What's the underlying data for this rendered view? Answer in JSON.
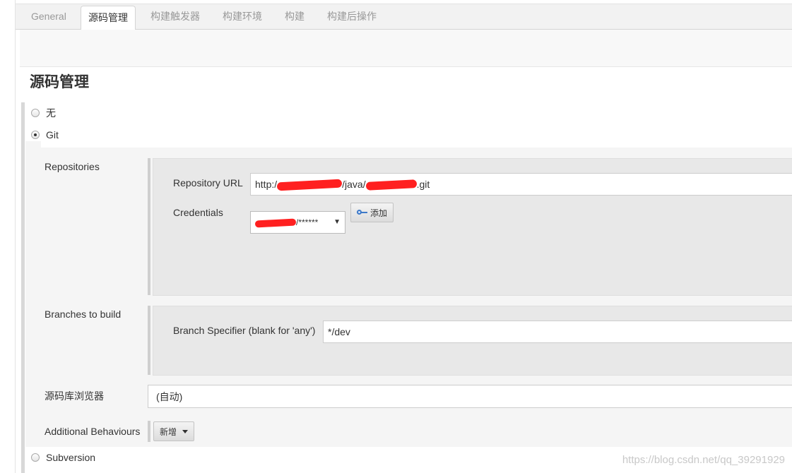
{
  "tabs": [
    {
      "label": "General",
      "active": false
    },
    {
      "label": "源码管理",
      "active": true
    },
    {
      "label": "构建触发器",
      "active": false
    },
    {
      "label": "构建环境",
      "active": false
    },
    {
      "label": "构建",
      "active": false
    },
    {
      "label": "构建后操作",
      "active": false
    }
  ],
  "section_title": "源码管理",
  "scm_options": {
    "none": {
      "label": "无",
      "selected": false
    },
    "git": {
      "label": "Git",
      "selected": true
    },
    "subversion": {
      "label": "Subversion",
      "selected": false
    }
  },
  "repositories": {
    "label": "Repositories",
    "url_label": "Repository URL",
    "url_prefix": "http:/",
    "url_mid": "/java/",
    "url_suffix": ".git",
    "credentials_label": "Credentials",
    "credentials_value": "/******",
    "add_button": "添加",
    "add_icon": "key-icon"
  },
  "branches": {
    "label": "Branches to build",
    "specifier_label": "Branch Specifier (blank for 'any')",
    "specifier_value": "*/dev"
  },
  "browser": {
    "label": "源码库浏览器",
    "value": "(自动)"
  },
  "behaviours": {
    "label": "Additional Behaviours",
    "add_button": "新增"
  },
  "watermark": "https://blog.csdn.net/qq_39291929",
  "colors": {
    "redaction": "#ff2020",
    "panel": "#f5f5f5",
    "subpanel": "#e8e8e8"
  }
}
